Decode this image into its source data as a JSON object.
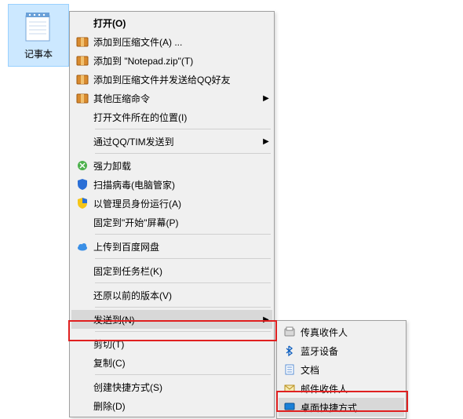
{
  "desktop": {
    "icon_label": "记事本"
  },
  "menu": {
    "open": "打开(O)",
    "add_to_archive": "添加到压缩文件(A) ...",
    "add_to_notepad_zip": "添加到 \"Notepad.zip\"(T)",
    "add_archive_qq": "添加到压缩文件并发送给QQ好友",
    "other_archive": "其他压缩命令",
    "open_file_location": "打开文件所在的位置(I)",
    "send_via_qq_tim": "通过QQ/TIM发送到",
    "force_uninstall": "强力卸载",
    "scan_virus": "扫描病毒(电脑管家)",
    "run_as_admin": "以管理员身份运行(A)",
    "pin_to_start": "固定到\"开始\"屏幕(P)",
    "upload_baidu": "上传到百度网盘",
    "pin_to_taskbar": "固定到任务栏(K)",
    "restore_previous": "还原以前的版本(V)",
    "send_to": "发送到(N)",
    "cut": "剪切(T)",
    "copy": "复制(C)",
    "create_shortcut": "创建快捷方式(S)",
    "delete": "删除(D)"
  },
  "submenu": {
    "fax_recipient": "传真收件人",
    "bluetooth": "蓝牙设备",
    "documents": "文档",
    "mail_recipient": "邮件收件人",
    "desktop_shortcut": "桌面快捷方式"
  }
}
